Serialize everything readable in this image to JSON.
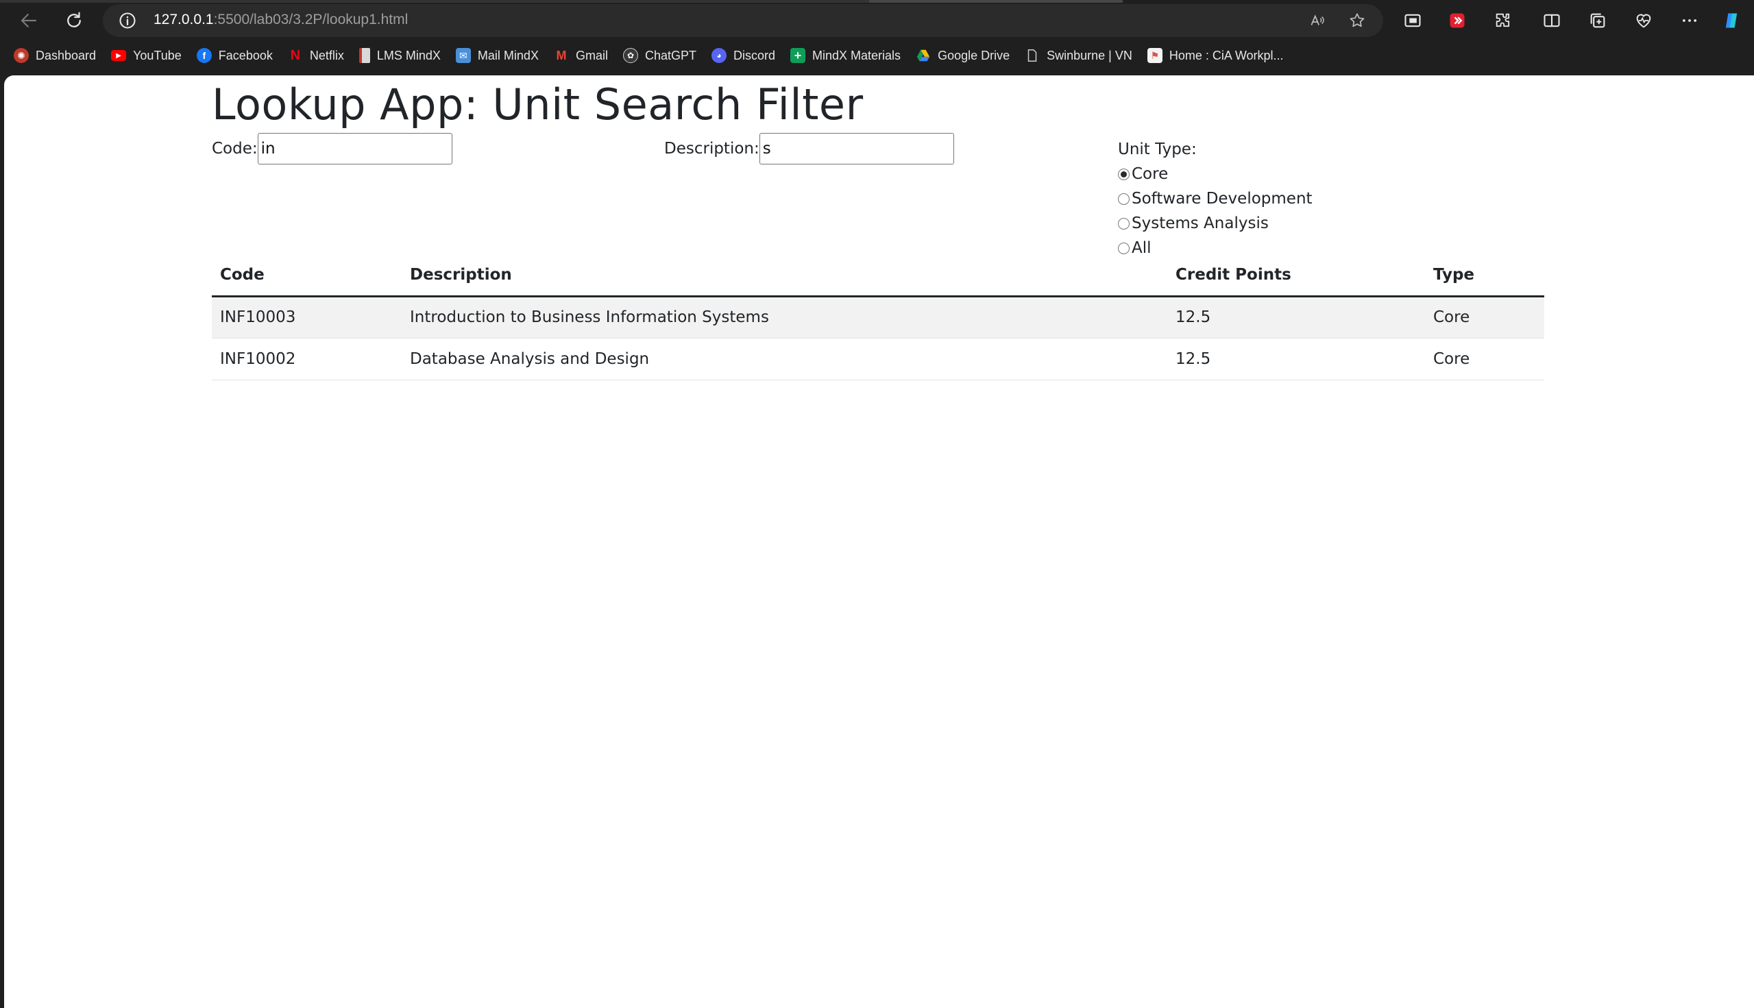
{
  "browser": {
    "url_host": "127.0.0.1",
    "url_rest": ":5500/lab03/3.2P/lookup1.html",
    "bookmarks": [
      {
        "label": "Dashboard",
        "icon": "dashboard-icon",
        "color": "#c0392b"
      },
      {
        "label": "YouTube",
        "icon": "youtube-icon",
        "color": "#ff0000"
      },
      {
        "label": "Facebook",
        "icon": "facebook-icon",
        "color": "#1877f2"
      },
      {
        "label": "Netflix",
        "icon": "netflix-icon",
        "color": "#e50914"
      },
      {
        "label": "LMS MindX",
        "icon": "lms-icon",
        "color": "#d9d9d9"
      },
      {
        "label": "Mail MindX",
        "icon": "mail-icon",
        "color": "#4a90d9"
      },
      {
        "label": "Gmail",
        "icon": "gmail-icon",
        "color": "#ea4335"
      },
      {
        "label": "ChatGPT",
        "icon": "chatgpt-icon",
        "color": "#cfcfcf"
      },
      {
        "label": "Discord",
        "icon": "discord-icon",
        "color": "#5865f2"
      },
      {
        "label": "MindX Materials",
        "icon": "sheets-icon",
        "color": "#0f9d58"
      },
      {
        "label": "Google Drive",
        "icon": "drive-icon",
        "color": "#fbbc04"
      },
      {
        "label": "Swinburne | VN",
        "icon": "page-icon",
        "color": "#cfcfcf"
      },
      {
        "label": "Home : CiA Workpl...",
        "icon": "cia-icon",
        "color": "#d9534f"
      }
    ]
  },
  "page": {
    "title": "Lookup App: Unit Search Filter",
    "code_label": "Code:",
    "code_value": "in",
    "description_label": "Description:",
    "description_value": "s",
    "unit_type_label": "Unit Type:",
    "unit_types": [
      {
        "label": "Core",
        "checked": true
      },
      {
        "label": "Software Development",
        "checked": false
      },
      {
        "label": "Systems Analysis",
        "checked": false
      },
      {
        "label": "All",
        "checked": false
      }
    ],
    "table": {
      "headers": [
        "Code",
        "Description",
        "Credit Points",
        "Type"
      ],
      "rows": [
        [
          "INF10003",
          "Introduction to Business Information Systems",
          "12.5",
          "Core"
        ],
        [
          "INF10002",
          "Database Analysis and Design",
          "12.5",
          "Core"
        ]
      ]
    }
  }
}
